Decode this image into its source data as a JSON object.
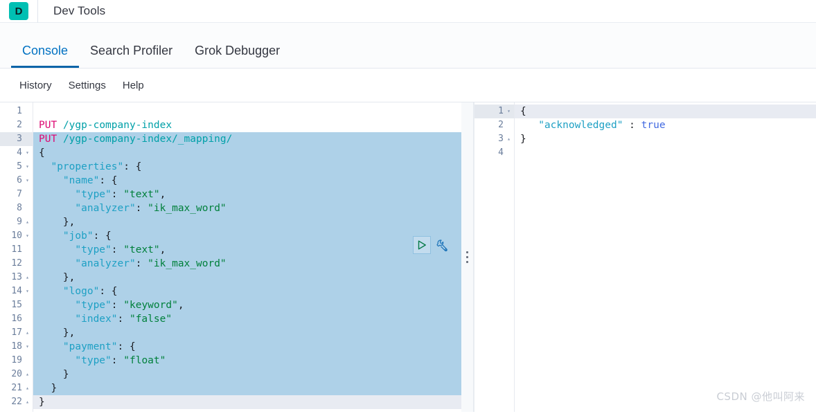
{
  "app": {
    "logo_letter": "D",
    "title": "Dev Tools"
  },
  "tabs": [
    {
      "label": "Console",
      "active": true
    },
    {
      "label": "Search Profiler",
      "active": false
    },
    {
      "label": "Grok Debugger",
      "active": false
    }
  ],
  "menu": [
    {
      "label": "History"
    },
    {
      "label": "Settings"
    },
    {
      "label": "Help"
    }
  ],
  "colors": {
    "brand_teal": "#00bfb3",
    "accent_blue": "#0071c2",
    "tab_underline": "#0a64a8",
    "selection": "#aed1e8",
    "active_line": "#e8ebf2",
    "method": "#dd0a73",
    "url": "#00a0a8",
    "json_key": "#1ea0c4",
    "json_string": "#00803b",
    "json_boolean": "#4169e1",
    "watermark": "#c9cdd4"
  },
  "request_editor": {
    "name": "console-request-editor",
    "total_lines": 22,
    "selected_line_range": [
      3,
      21
    ],
    "cursor_line": 22,
    "lines": [
      {
        "n": 1,
        "fold": "",
        "selected": false,
        "cursor": false,
        "tokens": []
      },
      {
        "n": 2,
        "fold": "",
        "selected": false,
        "cursor": false,
        "tokens": [
          {
            "t": "method",
            "v": "PUT"
          },
          {
            "t": "punc",
            "v": " "
          },
          {
            "t": "url",
            "v": "/ygp-company-index"
          }
        ]
      },
      {
        "n": 3,
        "fold": "",
        "selected": true,
        "cursor": false,
        "gutter_active": true,
        "tokens": [
          {
            "t": "method",
            "v": "PUT"
          },
          {
            "t": "punc",
            "v": " "
          },
          {
            "t": "url",
            "v": "/ygp-company-index/_mapping/"
          }
        ]
      },
      {
        "n": 4,
        "fold": "down",
        "selected": true,
        "cursor": false,
        "tokens": [
          {
            "t": "punc",
            "v": "{"
          }
        ]
      },
      {
        "n": 5,
        "fold": "down",
        "selected": true,
        "cursor": false,
        "tokens": [
          {
            "t": "punc",
            "v": "  "
          },
          {
            "t": "key",
            "v": "\"properties\""
          },
          {
            "t": "punc",
            "v": ": {"
          }
        ]
      },
      {
        "n": 6,
        "fold": "down",
        "selected": true,
        "cursor": false,
        "tokens": [
          {
            "t": "punc",
            "v": "    "
          },
          {
            "t": "key",
            "v": "\"name\""
          },
          {
            "t": "punc",
            "v": ": {"
          }
        ]
      },
      {
        "n": 7,
        "fold": "",
        "selected": true,
        "cursor": false,
        "tokens": [
          {
            "t": "punc",
            "v": "      "
          },
          {
            "t": "key",
            "v": "\"type\""
          },
          {
            "t": "punc",
            "v": ": "
          },
          {
            "t": "str",
            "v": "\"text\""
          },
          {
            "t": "punc",
            "v": ","
          }
        ]
      },
      {
        "n": 8,
        "fold": "",
        "selected": true,
        "cursor": false,
        "tokens": [
          {
            "t": "punc",
            "v": "      "
          },
          {
            "t": "key",
            "v": "\"analyzer\""
          },
          {
            "t": "punc",
            "v": ": "
          },
          {
            "t": "str",
            "v": "\"ik_max_word\""
          }
        ]
      },
      {
        "n": 9,
        "fold": "up",
        "selected": true,
        "cursor": false,
        "tokens": [
          {
            "t": "punc",
            "v": "    },"
          }
        ]
      },
      {
        "n": 10,
        "fold": "down",
        "selected": true,
        "cursor": false,
        "tokens": [
          {
            "t": "punc",
            "v": "    "
          },
          {
            "t": "key",
            "v": "\"job\""
          },
          {
            "t": "punc",
            "v": ": {"
          }
        ]
      },
      {
        "n": 11,
        "fold": "",
        "selected": true,
        "cursor": false,
        "tokens": [
          {
            "t": "punc",
            "v": "      "
          },
          {
            "t": "key",
            "v": "\"type\""
          },
          {
            "t": "punc",
            "v": ": "
          },
          {
            "t": "str",
            "v": "\"text\""
          },
          {
            "t": "punc",
            "v": ","
          }
        ]
      },
      {
        "n": 12,
        "fold": "",
        "selected": true,
        "cursor": false,
        "tokens": [
          {
            "t": "punc",
            "v": "      "
          },
          {
            "t": "key",
            "v": "\"analyzer\""
          },
          {
            "t": "punc",
            "v": ": "
          },
          {
            "t": "str",
            "v": "\"ik_max_word\""
          }
        ]
      },
      {
        "n": 13,
        "fold": "up",
        "selected": true,
        "cursor": false,
        "tokens": [
          {
            "t": "punc",
            "v": "    },"
          }
        ]
      },
      {
        "n": 14,
        "fold": "down",
        "selected": true,
        "cursor": false,
        "tokens": [
          {
            "t": "punc",
            "v": "    "
          },
          {
            "t": "key",
            "v": "\"logo\""
          },
          {
            "t": "punc",
            "v": ": {"
          }
        ]
      },
      {
        "n": 15,
        "fold": "",
        "selected": true,
        "cursor": false,
        "tokens": [
          {
            "t": "punc",
            "v": "      "
          },
          {
            "t": "key",
            "v": "\"type\""
          },
          {
            "t": "punc",
            "v": ": "
          },
          {
            "t": "str",
            "v": "\"keyword\""
          },
          {
            "t": "punc",
            "v": ","
          }
        ]
      },
      {
        "n": 16,
        "fold": "",
        "selected": true,
        "cursor": false,
        "tokens": [
          {
            "t": "punc",
            "v": "      "
          },
          {
            "t": "key",
            "v": "\"index\""
          },
          {
            "t": "punc",
            "v": ": "
          },
          {
            "t": "str",
            "v": "\"false\""
          }
        ]
      },
      {
        "n": 17,
        "fold": "up",
        "selected": true,
        "cursor": false,
        "tokens": [
          {
            "t": "punc",
            "v": "    },"
          }
        ]
      },
      {
        "n": 18,
        "fold": "down",
        "selected": true,
        "cursor": false,
        "tokens": [
          {
            "t": "punc",
            "v": "    "
          },
          {
            "t": "key",
            "v": "\"payment\""
          },
          {
            "t": "punc",
            "v": ": {"
          }
        ]
      },
      {
        "n": 19,
        "fold": "",
        "selected": true,
        "cursor": false,
        "tokens": [
          {
            "t": "punc",
            "v": "      "
          },
          {
            "t": "key",
            "v": "\"type\""
          },
          {
            "t": "punc",
            "v": ": "
          },
          {
            "t": "str",
            "v": "\"float\""
          }
        ]
      },
      {
        "n": 20,
        "fold": "up",
        "selected": true,
        "cursor": false,
        "tokens": [
          {
            "t": "punc",
            "v": "    }"
          }
        ]
      },
      {
        "n": 21,
        "fold": "up",
        "selected": true,
        "cursor": false,
        "tokens": [
          {
            "t": "punc",
            "v": "  }"
          }
        ]
      },
      {
        "n": 22,
        "fold": "up",
        "selected": false,
        "cursor": true,
        "tokens": [
          {
            "t": "punc",
            "v": "}"
          }
        ]
      }
    ]
  },
  "response_editor": {
    "name": "console-response-viewer",
    "total_lines": 4,
    "lines": [
      {
        "n": 1,
        "fold": "down",
        "active": true,
        "tokens": [
          {
            "t": "punc",
            "v": "{"
          }
        ]
      },
      {
        "n": 2,
        "fold": "",
        "active": false,
        "tokens": [
          {
            "t": "punc",
            "v": "   "
          },
          {
            "t": "key",
            "v": "\"acknowledged\""
          },
          {
            "t": "punc",
            "v": " : "
          },
          {
            "t": "bool",
            "v": "true"
          }
        ]
      },
      {
        "n": 3,
        "fold": "up",
        "active": false,
        "tokens": [
          {
            "t": "punc",
            "v": "}"
          }
        ]
      },
      {
        "n": 4,
        "fold": "",
        "active": false,
        "tokens": []
      }
    ]
  },
  "toolbar": {
    "play_label": "Click to send request",
    "wrench_label": "Open documentation",
    "play_icon": "play-triangle-icon",
    "wrench_icon": "wrench-icon"
  },
  "splitter": {
    "icon": "drag-handle-dots-icon"
  },
  "watermark": {
    "text": "CSDN @他叫阿来"
  }
}
